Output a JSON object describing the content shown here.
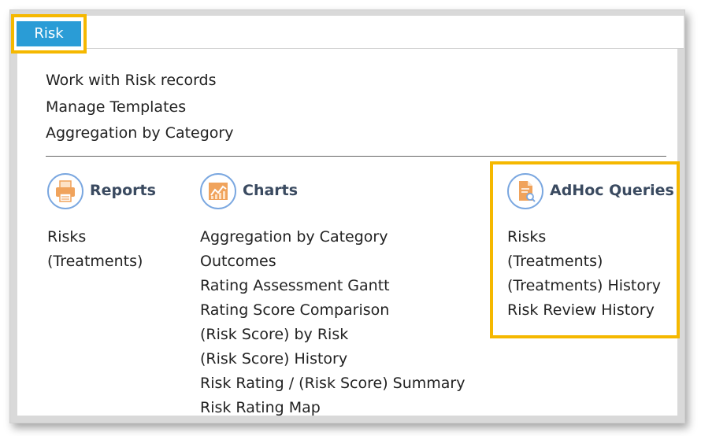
{
  "tab": {
    "label": "Risk"
  },
  "top_links": [
    "Work with Risk records",
    "Manage Templates",
    "Aggregation by Category"
  ],
  "sections": {
    "reports": {
      "title": "Reports",
      "icon": "printer-icon",
      "items": [
        "Risks",
        "(Treatments)"
      ]
    },
    "charts": {
      "title": "Charts",
      "icon": "chart-icon",
      "items": [
        "Aggregation by Category",
        "Outcomes",
        "Rating Assessment Gantt",
        "Rating Score Comparison",
        "(Risk Score) by Risk",
        "(Risk Score) History",
        "Risk Rating / (Risk Score) Summary",
        "Risk Rating Map"
      ]
    },
    "adhoc": {
      "title": "AdHoc Queries",
      "icon": "document-search-icon",
      "items": [
        "Risks",
        "(Treatments)",
        "(Treatments) History",
        "Risk Review History"
      ]
    }
  },
  "colors": {
    "tab_blue": "#2a9cd6",
    "highlight": "#f5b800",
    "icon_orange": "#f0a35c",
    "icon_ring": "#7aa7e0",
    "title_text": "#3a4a60"
  }
}
